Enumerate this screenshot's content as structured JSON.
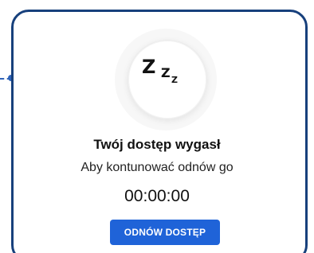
{
  "icon": {
    "name": "sleep-zzz-icon",
    "glyphs": [
      "Z",
      "Z",
      "Z"
    ]
  },
  "message": {
    "title": "Twój dostęp wygasł",
    "subtitle": "Aby kontunować odnów go",
    "countdown": "00:00:00"
  },
  "actions": {
    "renew_label": "ODNÓW DOSTĘP"
  },
  "colors": {
    "accent": "#1f63d8",
    "frame": "#17407c",
    "connector": "#2f63b8"
  }
}
